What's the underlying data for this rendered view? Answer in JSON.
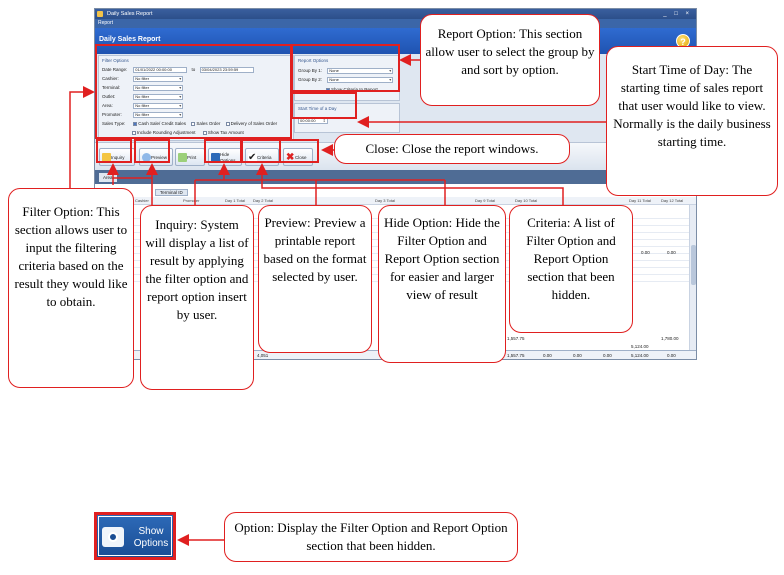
{
  "window": {
    "title": "Daily Sales Report",
    "controls": "_ □ ×",
    "menu": "Report",
    "header": "Daily Sales Report",
    "help_glyph": "?"
  },
  "filter_options": {
    "title": "Filter Options",
    "date_range_label": "Date Range:",
    "date_from": "01/01/2022 00:00:00",
    "date_to_label": "to",
    "date_to": "03/04/2023 23:59:59",
    "fields": [
      {
        "label": "Cashier:",
        "value": "No filter"
      },
      {
        "label": "Terminal:",
        "value": "No filter"
      },
      {
        "label": "Outlet:",
        "value": "No filter"
      },
      {
        "label": "Area:",
        "value": "No filter"
      },
      {
        "label": "Promoter:",
        "value": "No filter"
      }
    ],
    "sales_type_label": "Sales Type:",
    "sales_types": [
      "Cash Sale/ Credit Sales",
      "Sales Order",
      "Delivery of Sales Order"
    ],
    "include_rounding": "Include Rounding Adjustment",
    "show_tax": "Show Tax Amount"
  },
  "report_options": {
    "title": "Report Options",
    "group_by_1_label": "Group By 1:",
    "group_by_1": "None",
    "group_by_2_label": "Group By 2:",
    "group_by_2": "None",
    "show_criteria": "Show Criteria In Report"
  },
  "start_time": {
    "title": "Start Time of a Day",
    "value": "00:00:00"
  },
  "toolbar": {
    "inquiry": "Inquiry",
    "preview": "Preview",
    "print": "Print",
    "hide_options_1": "Hide",
    "hide_options_2": "Options",
    "criteria": "Criteria",
    "close": "Close"
  },
  "grid": {
    "area_tab": "Area",
    "terminal_tab": "Terminal ID",
    "headers": [
      "Cashier",
      "Promoter",
      "Day 1 Total",
      "Day 2 Total",
      "Day 3 Total",
      "Day 9 Total",
      "Day 10 Total",
      "Day 11 Total",
      "Day 12 Total"
    ],
    "row_values": [
      "0.00",
      "0.00"
    ],
    "subtotal_1": "1,557.75",
    "subtotal_2": "1,780.00",
    "subtotal_3": "5,124.00",
    "footer": [
      "4,051",
      "1,557.75",
      "0.00",
      "0.00",
      "0.00",
      "5,124.00",
      "0.00"
    ]
  },
  "callouts": {
    "report_option": "Report Option: This section allow user to select the group by and sort by option.",
    "start_time": "Start Time of Day: The starting time of sales report that user would like to view. Normally is the daily business starting time.",
    "close": "Close: Close the report windows.",
    "filter_option": "Filter Option: This section allows user to input the filtering criteria based on the result they would like to obtain.",
    "inquiry": "Inquiry: System will display a list of result by applying the filter option and report option insert by user.",
    "preview": "Preview: Preview a printable report based on the format selected by user.",
    "hide_option": "Hide Option: Hide the Filter Option and Report Option section for easier and larger view of result",
    "criteria": "Criteria: A list of Filter Option and Report Option section that been hidden.",
    "show_options": "Option: Display the Filter Option and Report Option section that been hidden."
  },
  "show_options_button": {
    "line1": "Show",
    "line2": "Options"
  },
  "colors": {
    "highlight": "#e02020",
    "header_blue": "#2f6bd1",
    "title_blue": "#3a5f9e"
  }
}
